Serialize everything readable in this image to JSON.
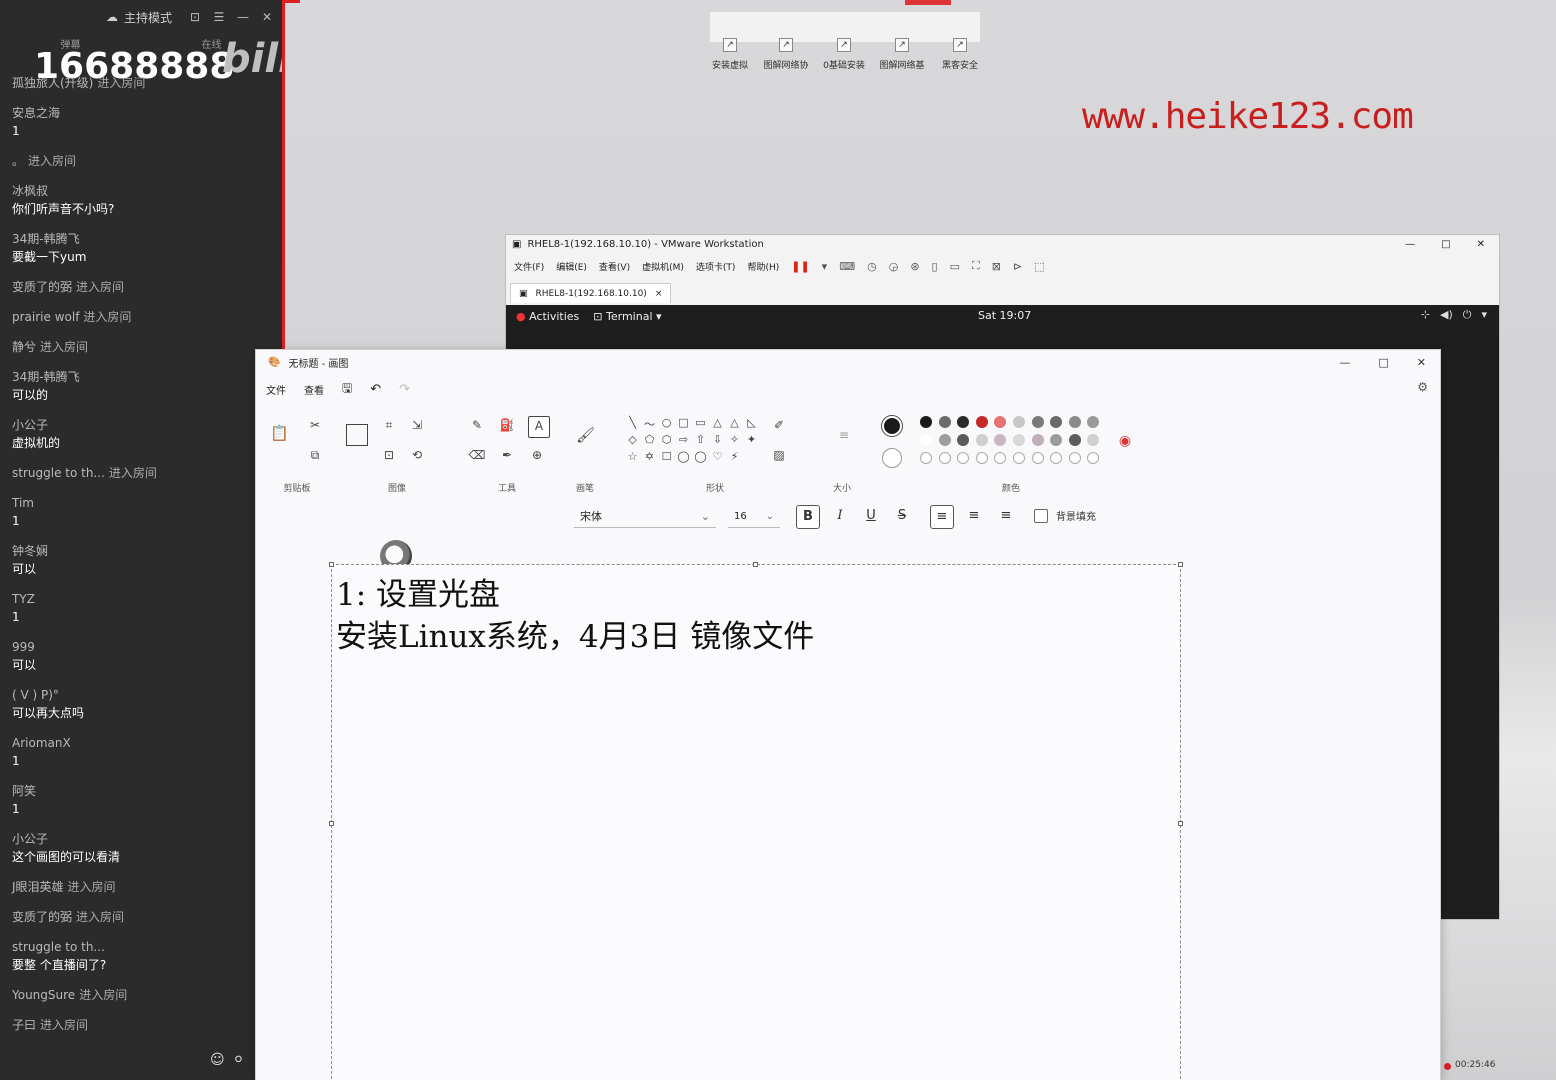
{
  "chat": {
    "mode_label": "主持模式",
    "window_buttons": [
      "⊡",
      "☰",
      "—",
      "✕"
    ],
    "tabs": [
      "弹幕",
      "在线"
    ],
    "room_number": "16688888",
    "logo_text": "bilibili",
    "messages": [
      {
        "user": "孤独旅人(升级)",
        "text": "",
        "join": "进入房间"
      },
      {
        "user": "安息之海",
        "text": "1",
        "join": ""
      },
      {
        "user": "。",
        "text": "",
        "join": "进入房间"
      },
      {
        "user": "冰枫叔",
        "text": "你们听声音不小吗?",
        "join": ""
      },
      {
        "user": "34期-韩腾飞",
        "text": "要截一下yum",
        "join": ""
      },
      {
        "user": "变质了的弼",
        "text": "",
        "join": "进入房间"
      },
      {
        "user": "prairie wolf",
        "text": "",
        "join": "进入房间"
      },
      {
        "user": "静兮",
        "text": "",
        "join": "进入房间"
      },
      {
        "user": "34期-韩腾飞",
        "text": "可以的",
        "join": ""
      },
      {
        "user": "小公子",
        "text": "虚拟机的",
        "join": ""
      },
      {
        "user": "struggle to th...",
        "text": "",
        "join": "进入房间"
      },
      {
        "user": "Tim",
        "text": "1",
        "join": ""
      },
      {
        "user": "钟冬娴",
        "text": "可以",
        "join": ""
      },
      {
        "user": "TYZ",
        "text": "1",
        "join": ""
      },
      {
        "user": "999",
        "text": "可以",
        "join": ""
      },
      {
        "user": "(   V   )   P)°",
        "text": "可以再大点吗",
        "join": ""
      },
      {
        "user": "AriomanX",
        "text": "1",
        "join": ""
      },
      {
        "user": "阿笑",
        "text": "1",
        "join": ""
      },
      {
        "user": "小公子",
        "text": "这个画图的可以看清",
        "join": ""
      },
      {
        "user": "J眼泪英雄",
        "text": "",
        "join": "进入房间"
      },
      {
        "user": "变质了的弼",
        "text": "",
        "join": "进入房间"
      },
      {
        "user": "struggle to th...",
        "text": "要整 个直播间了?",
        "join": ""
      },
      {
        "user": "YoungSure",
        "text": "",
        "join": "进入房间"
      },
      {
        "user": "子曰",
        "text": "",
        "join": "进入房间"
      }
    ],
    "bottom_icons": [
      "☺",
      "⚪"
    ]
  },
  "desktop": {
    "website": "www.heike123.com",
    "icons": [
      {
        "label": "安装虚拟",
        "icon": "shortcut-icon"
      },
      {
        "label": "图解网络协",
        "icon": "shortcut-icon"
      },
      {
        "label": "0基础安装",
        "icon": "shortcut-icon"
      },
      {
        "label": "图解网络基",
        "icon": "shortcut-icon"
      },
      {
        "label": "黑客安全",
        "icon": "shortcut-icon"
      }
    ]
  },
  "vmware": {
    "title": "RHEL8-1(192.168.10.10) - VMware Workstation",
    "window_buttons": [
      "—",
      "□",
      "✕"
    ],
    "menus": [
      "文件(F)",
      "编辑(E)",
      "查看(V)",
      "虚拟机(M)",
      "选项卡(T)",
      "帮助(H)"
    ],
    "tab_label": "RHEL8-1(192.168.10.10)",
    "gnome": {
      "activities": "Activities",
      "terminal": "Terminal ▾",
      "clock": "Sat 19:07",
      "sys_icons": [
        "⊹",
        "◀)",
        "⏻",
        "▾"
      ]
    },
    "status_time": "00:25:46"
  },
  "paint": {
    "title": "无标题 - 画图",
    "window_buttons": [
      "—",
      "□",
      "✕"
    ],
    "menus": [
      "文件",
      "查看"
    ],
    "groups": [
      {
        "label": "剪贴板"
      },
      {
        "label": "图像"
      },
      {
        "label": "工具"
      },
      {
        "label": "画笔"
      },
      {
        "label": "形状"
      },
      {
        "label": "大小"
      },
      {
        "label": "颜色"
      }
    ],
    "shapes": [
      "╲",
      "〜",
      "○",
      "□",
      "▭",
      "△",
      "△",
      "◺",
      "◇",
      "⬠",
      "⬡",
      "⇨",
      "⇧",
      "⇩",
      "✧",
      "✦",
      "☆",
      "✡",
      "☐",
      "◯",
      "◯",
      "♡",
      "⚡",
      "  "
    ],
    "palette_row1": [
      "#1a1a1a",
      "#6b6b6b",
      "#2a2a2a",
      "#c62828",
      "#e57373",
      "#c7c7c7",
      "#7a7a7a",
      "#6a6a6a",
      "#8a8a8a",
      "#9a9a9a"
    ],
    "palette_row2": [
      "#ffffff",
      "#9e9e9e",
      "#5a5a5a",
      "#cfcfcf",
      "#c8b8c0",
      "#d8d8d8",
      "#c0b0b8",
      "#9c9c9c",
      "#5c5c5c",
      "#d0d0d0"
    ],
    "font_name": "宋体",
    "font_size": "16",
    "bg_fill_label": "背景填充",
    "canvas_lines": [
      "1: 设置光盘",
      "安装Linux系统，4月3日 镜像文件"
    ]
  }
}
